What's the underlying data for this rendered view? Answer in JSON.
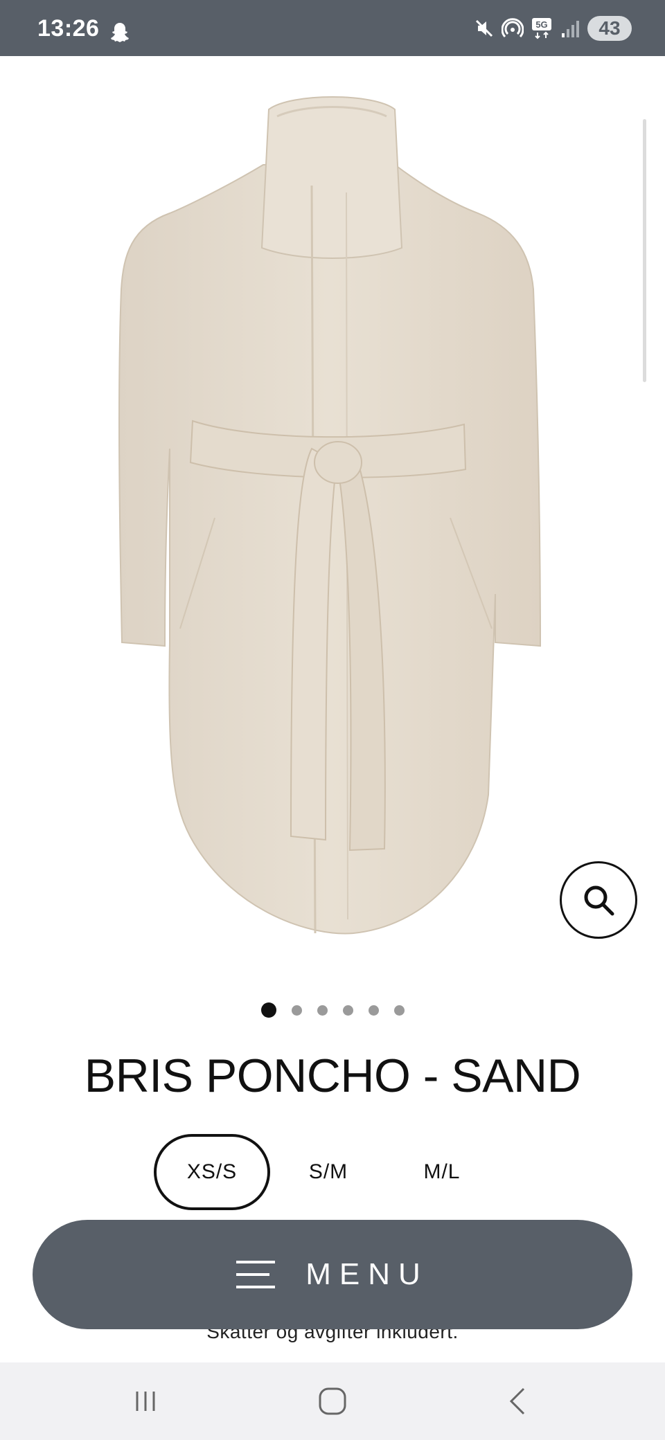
{
  "status_bar": {
    "time": "13:26",
    "battery": "43",
    "icons": [
      "snapchat-icon",
      "mute-icon",
      "hotspot-icon",
      "5g-icon",
      "signal-icon"
    ]
  },
  "product": {
    "title": "BRIS PONCHO - SAND",
    "image_count": 6,
    "active_image": 1,
    "sizes": [
      "XS/S",
      "S/M",
      "M/L"
    ],
    "selected_size": "XS/S",
    "tax_note": "Skatter og avgifter inkludert."
  },
  "menu": {
    "label": "MENU"
  },
  "colors": {
    "status_bar_bg": "#585f68",
    "menu_bg": "#585f68",
    "coat": "#e6ddd0",
    "nav_bg": "#f1f1f3"
  }
}
